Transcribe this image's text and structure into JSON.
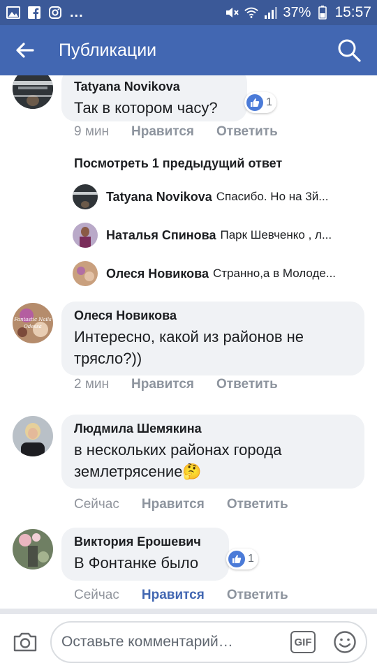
{
  "statusbar": {
    "battery_pct": "37%",
    "time": "15:57",
    "more": "...",
    "icons": [
      "gallery-icon",
      "facebook-icon",
      "instagram-icon",
      "mute-icon",
      "wifi-icon",
      "signal-icon",
      "battery-icon"
    ]
  },
  "appbar": {
    "title": "Публикации",
    "back_icon": "back-arrow-icon",
    "search_icon": "search-icon"
  },
  "comments": [
    {
      "author": "Tatyana Novikova",
      "text": "Так в котором часу?",
      "time": "9 мин",
      "like_label": "Нравится",
      "reply_label": "Ответить",
      "likes": "1"
    },
    {
      "author": "Олеся Новикова",
      "text": "Интересно, какой из районов не трясло?))",
      "time": "2 мин",
      "like_label": "Нравится",
      "reply_label": "Ответить"
    },
    {
      "author": "Людмила Шемякина",
      "text": "в нескольких районах города землетрясение🤔",
      "time": "Сейчас",
      "like_label": "Нравится",
      "reply_label": "Ответить"
    },
    {
      "author": "Виктория Ерошевич",
      "text": "В Фонтанке было",
      "time": "Сейчас",
      "like_label": "Нравится",
      "reply_label": "Ответить",
      "likes": "1",
      "liked": true
    }
  ],
  "replies_thread": {
    "prev_label": "Посмотреть 1 предыдущий ответ",
    "replies": [
      {
        "author": "Tatyana Novikova",
        "text": "Спасибо. Но на 3й..."
      },
      {
        "author": "Наталья Спинова",
        "text": "Парк Шевченко , л..."
      },
      {
        "author": "Олеся Новикова",
        "text": "Странно,а в Молоде..."
      }
    ]
  },
  "composer": {
    "placeholder": "Оставьте комментарий…",
    "gif_label": "GIF",
    "camera_icon": "camera-icon",
    "emoji_icon": "emoji-icon"
  },
  "colors": {
    "statusbar": "#3b5998",
    "appbar": "#4267b2",
    "bubble": "#f0f2f5",
    "liked": "#4267b2",
    "like_badge": "#4b7bd8"
  },
  "avatar_logo_text": "Fantastic Nails Odessa"
}
